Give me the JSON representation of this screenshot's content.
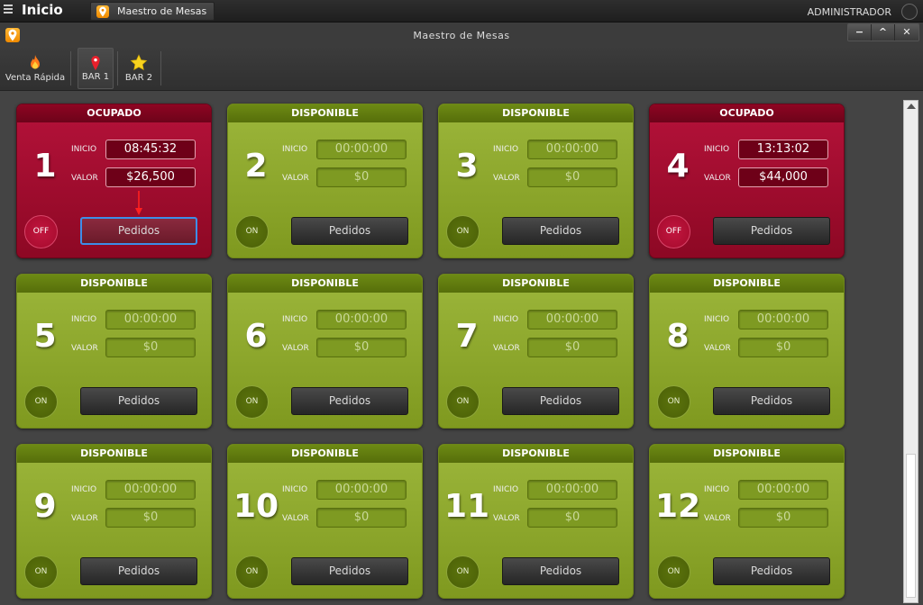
{
  "taskbar": {
    "home_label": "Inicio",
    "tab_label": "Maestro de Mesas",
    "user_label": "ADMINISTRADOR"
  },
  "window": {
    "title": "Maestro de Mesas",
    "controls": [
      "−",
      "^",
      "✕"
    ]
  },
  "toolbar": {
    "items": [
      {
        "label": "Venta Rápida",
        "icon": "flame-icon"
      },
      {
        "label": "BAR 1",
        "icon": "map-pin-icon",
        "active": true
      },
      {
        "label": "BAR 2",
        "icon": "star-icon"
      }
    ]
  },
  "labels": {
    "start": "INICIO",
    "value": "VALOR",
    "orders": "Pedidos"
  },
  "colors": {
    "free": "#8fab2e",
    "busy": "#a10d30",
    "focus": "#3d8ee8",
    "accent": "#f59a00"
  },
  "tables": [
    {
      "number": "1",
      "status": "OCUPADO",
      "start": "08:45:32",
      "value": "$26,500",
      "toggle": "OFF",
      "busy": true,
      "focused": true
    },
    {
      "number": "2",
      "status": "DISPONIBLE",
      "start": "00:00:00",
      "value": "$0",
      "toggle": "ON",
      "busy": false
    },
    {
      "number": "3",
      "status": "DISPONIBLE",
      "start": "00:00:00",
      "value": "$0",
      "toggle": "ON",
      "busy": false
    },
    {
      "number": "4",
      "status": "OCUPADO",
      "start": "13:13:02",
      "value": "$44,000",
      "toggle": "OFF",
      "busy": true
    },
    {
      "number": "5",
      "status": "DISPONIBLE",
      "start": "00:00:00",
      "value": "$0",
      "toggle": "ON",
      "busy": false
    },
    {
      "number": "6",
      "status": "DISPONIBLE",
      "start": "00:00:00",
      "value": "$0",
      "toggle": "ON",
      "busy": false
    },
    {
      "number": "7",
      "status": "DISPONIBLE",
      "start": "00:00:00",
      "value": "$0",
      "toggle": "ON",
      "busy": false
    },
    {
      "number": "8",
      "status": "DISPONIBLE",
      "start": "00:00:00",
      "value": "$0",
      "toggle": "ON",
      "busy": false
    },
    {
      "number": "9",
      "status": "DISPONIBLE",
      "start": "00:00:00",
      "value": "$0",
      "toggle": "ON",
      "busy": false
    },
    {
      "number": "10",
      "status": "DISPONIBLE",
      "start": "00:00:00",
      "value": "$0",
      "toggle": "ON",
      "busy": false
    },
    {
      "number": "11",
      "status": "DISPONIBLE",
      "start": "00:00:00",
      "value": "$0",
      "toggle": "ON",
      "busy": false
    },
    {
      "number": "12",
      "status": "DISPONIBLE",
      "start": "00:00:00",
      "value": "$0",
      "toggle": "ON",
      "busy": false
    }
  ]
}
